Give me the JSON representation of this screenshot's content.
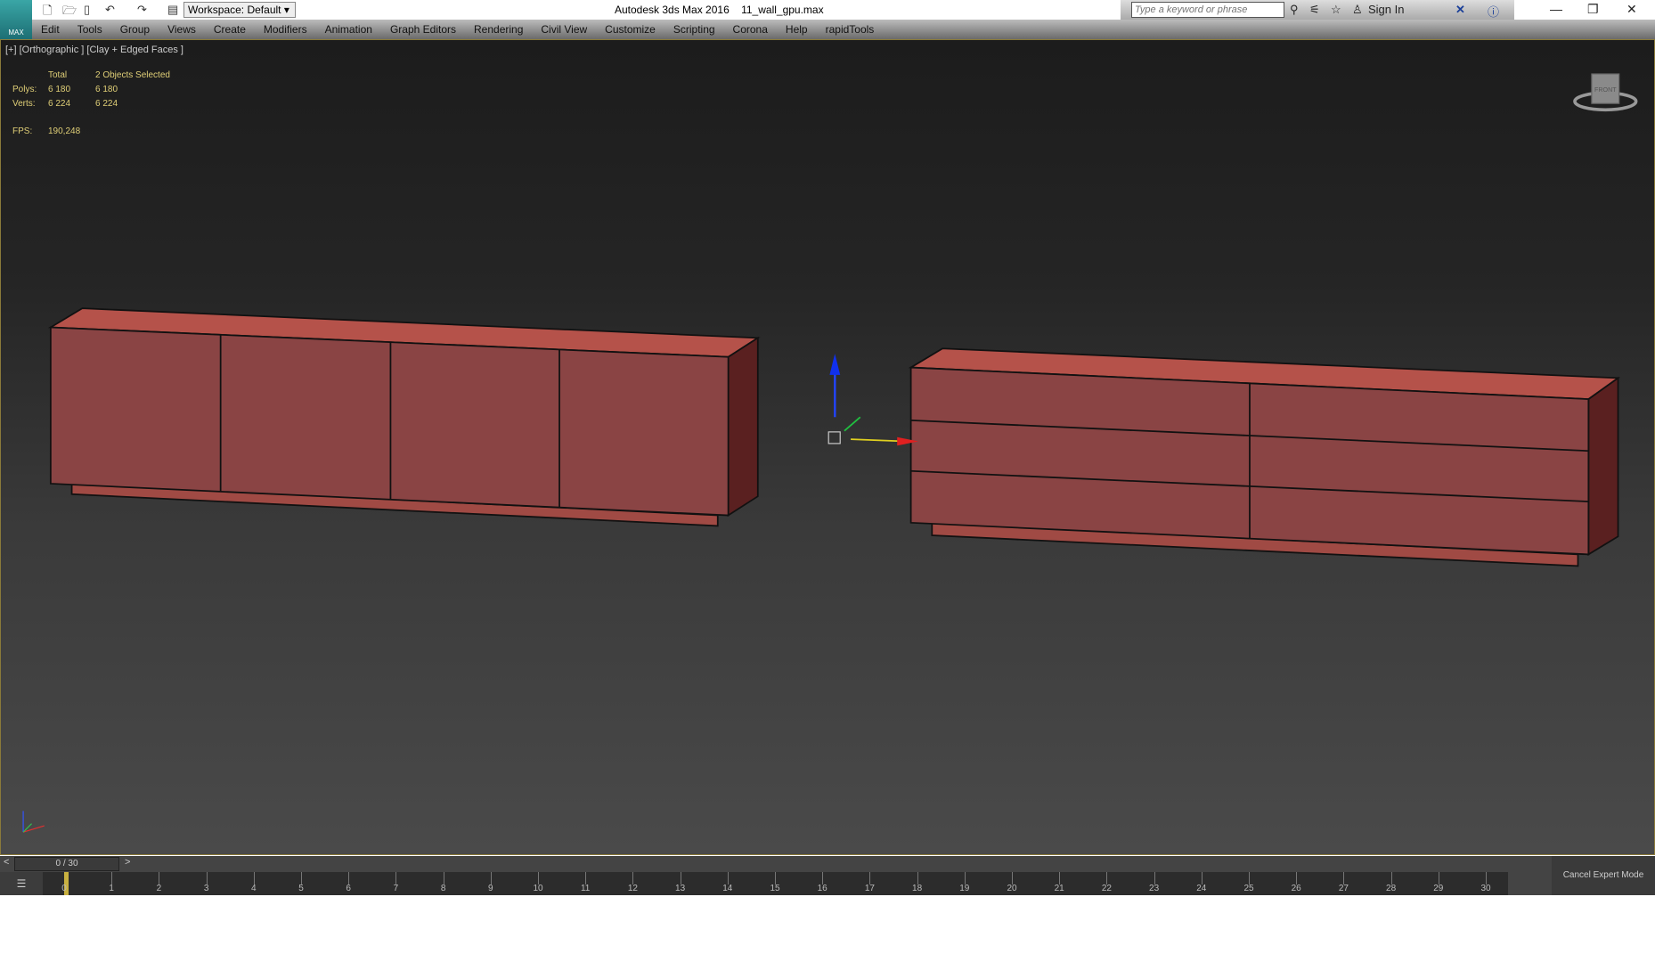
{
  "titlebar": {
    "app_title": "Autodesk 3ds Max 2016",
    "file": "11_wall_gpu.max",
    "workspace": "Workspace: Default",
    "search_placeholder": "Type a keyword or phrase",
    "sign_in": "Sign In",
    "logo": "MAX"
  },
  "menu": [
    "Edit",
    "Tools",
    "Group",
    "Views",
    "Create",
    "Modifiers",
    "Animation",
    "Graph Editors",
    "Rendering",
    "Civil View",
    "Customize",
    "Scripting",
    "Corona",
    "Help",
    "rapidTools"
  ],
  "viewport": {
    "label": "[+] [Orthographic ] [Clay + Edged Faces ]",
    "stats": {
      "total": "Total",
      "selected": "2 Objects Selected",
      "polys_label": "Polys:",
      "polys_total": "6 180",
      "polys_sel": "6 180",
      "verts_label": "Verts:",
      "verts_total": "6 224",
      "verts_sel": "6 224",
      "fps_label": "FPS:",
      "fps": "190,248"
    },
    "viewcube": "FRONT",
    "object_color": "#8a4444"
  },
  "timeline": {
    "frame": "0 / 30",
    "current": 0,
    "ticks": [
      "0",
      "1",
      "2",
      "3",
      "4",
      "5",
      "6",
      "7",
      "8",
      "9",
      "10",
      "11",
      "12",
      "13",
      "14",
      "15",
      "16",
      "17",
      "18",
      "19",
      "20",
      "21",
      "22",
      "23",
      "24",
      "25",
      "26",
      "27",
      "28",
      "29",
      "30"
    ],
    "cancel_expert": "Cancel Expert Mode"
  }
}
